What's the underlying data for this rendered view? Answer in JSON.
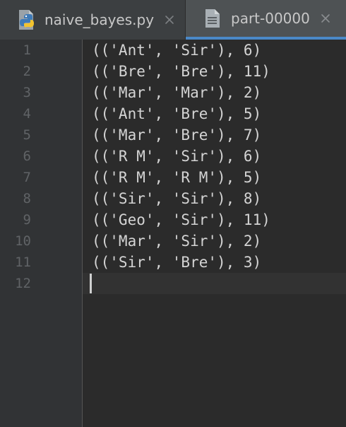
{
  "tabs": [
    {
      "label": "naive_bayes.py",
      "icon": "python-file-icon",
      "active": false
    },
    {
      "label": "part-00000",
      "icon": "text-file-icon",
      "active": true
    }
  ],
  "close_glyph": "close-icon",
  "accent_color": "#4a88c7",
  "editor": {
    "line_numbers": [
      "1",
      "2",
      "3",
      "4",
      "5",
      "6",
      "7",
      "8",
      "9",
      "10",
      "11",
      "12"
    ],
    "lines": [
      "(('Ant', 'Sir'), 6)",
      "(('Bre', 'Bre'), 11)",
      "(('Mar', 'Mar'), 2)",
      "(('Ant', 'Bre'), 5)",
      "(('Mar', 'Bre'), 7)",
      "(('R M', 'Sir'), 6)",
      "(('R M', 'R M'), 5)",
      "(('Sir', 'Sir'), 8)",
      "(('Geo', 'Sir'), 11)",
      "(('Mar', 'Sir'), 2)",
      "(('Sir', 'Bre'), 3)",
      ""
    ],
    "current_line": 12
  }
}
